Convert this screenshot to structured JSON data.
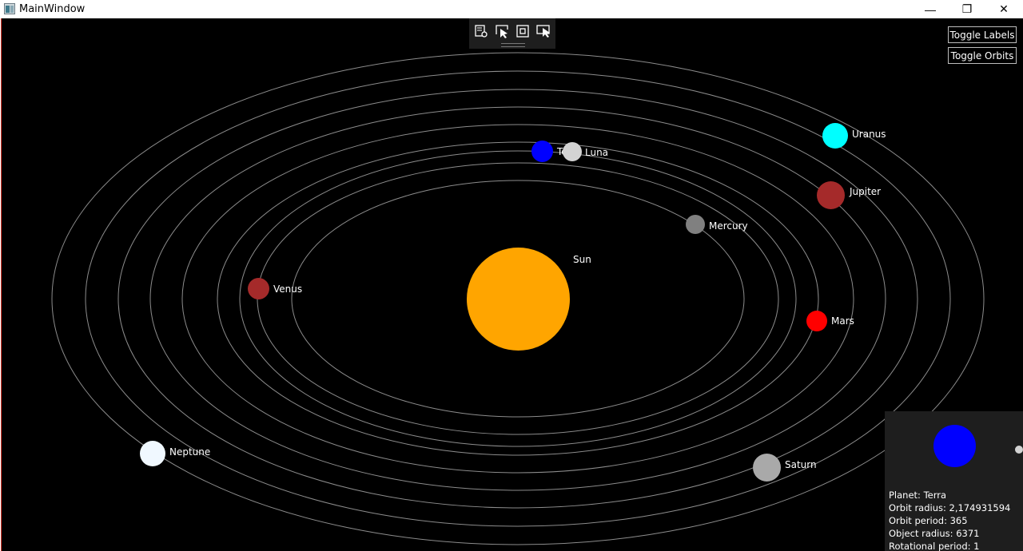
{
  "window": {
    "title": "MainWindow",
    "controls": {
      "minimize": "—",
      "maximize": "❐",
      "close": "✕"
    }
  },
  "toolbar": {
    "icons": [
      "settings-list-icon",
      "select-cursor-icon",
      "frame-icon",
      "track-cursor-icon"
    ]
  },
  "buttons": {
    "toggle_labels": "Toggle Labels",
    "toggle_orbits": "Toggle Orbits"
  },
  "bodies": {
    "sun": {
      "name": "Sun",
      "color": "#ffa500"
    },
    "mercury": {
      "name": "Mercury",
      "color": "#808080"
    },
    "venus": {
      "name": "Venus",
      "color": "#a52a2a"
    },
    "terra": {
      "name": "Terra",
      "color": "#0000ff"
    },
    "luna": {
      "name": "Luna",
      "color": "#d3d3d3"
    },
    "mars": {
      "name": "Mars",
      "color": "#ff0000"
    },
    "jupiter": {
      "name": "Jupiter",
      "color": "#a52a2a"
    },
    "saturn": {
      "name": "Saturn",
      "color": "#a9a9a9"
    },
    "uranus": {
      "name": "Uranus",
      "color": "#00ffff"
    },
    "neptune": {
      "name": "Neptune",
      "color": "#f0f8ff"
    }
  },
  "info": {
    "planet": "Planet: Terra",
    "orbit_radius": "Orbit radius: 2,174931594",
    "orbit_period": "Orbit period: 365",
    "object_radius": "Object radius: 6371",
    "rotational_period": "Rotational period: 1"
  }
}
